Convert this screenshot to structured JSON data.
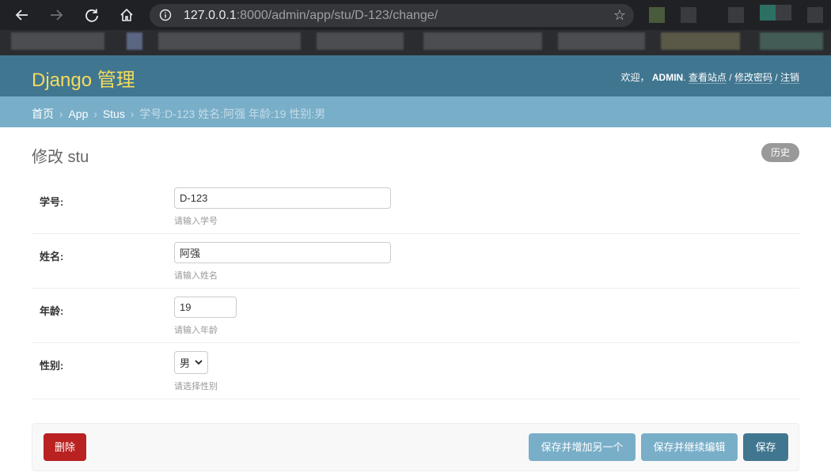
{
  "browser": {
    "url_host": "127.0.0.1",
    "url_rest": ":8000/admin/app/stu/D-123/change/",
    "back_icon": "arrow-left-icon",
    "forward_icon": "arrow-right-icon",
    "reload_icon": "reload-icon",
    "home_icon": "home-icon",
    "info_icon": "info-icon",
    "star_icon": "star-icon",
    "star_glyph": "☆"
  },
  "header": {
    "brand": "Django 管理",
    "welcome": "欢迎，",
    "username": "ADMIN",
    "view_site": "查看站点",
    "change_password": "修改密码",
    "logout": "注销",
    "separator": "/"
  },
  "breadcrumbs": {
    "home": "首页",
    "app": "App",
    "model": "Stus",
    "current": "学号:D-123 姓名:阿强 年龄:19 性别:男",
    "separator": "›"
  },
  "main": {
    "title": "修改 stu",
    "history_button": "历史"
  },
  "form": {
    "fields": [
      {
        "label": "学号:",
        "value": "D-123",
        "help": "请输入学号"
      },
      {
        "label": "姓名:",
        "value": "阿强",
        "help": "请输入姓名"
      },
      {
        "label": "年龄:",
        "value": "19",
        "help": "请输入年龄"
      },
      {
        "label": "性别:",
        "value": "男",
        "help": "请选择性别"
      }
    ]
  },
  "actions": {
    "delete": "删除",
    "save_add_another": "保存并增加另一个",
    "save_continue": "保存并继续编辑",
    "save": "保存"
  },
  "colors": {
    "header_bg": "#417690",
    "brand_yellow": "#f5dd5d",
    "breadcrumb_bg": "#79aec8",
    "delete_red": "#ba2121",
    "save_blue": "#417690"
  }
}
